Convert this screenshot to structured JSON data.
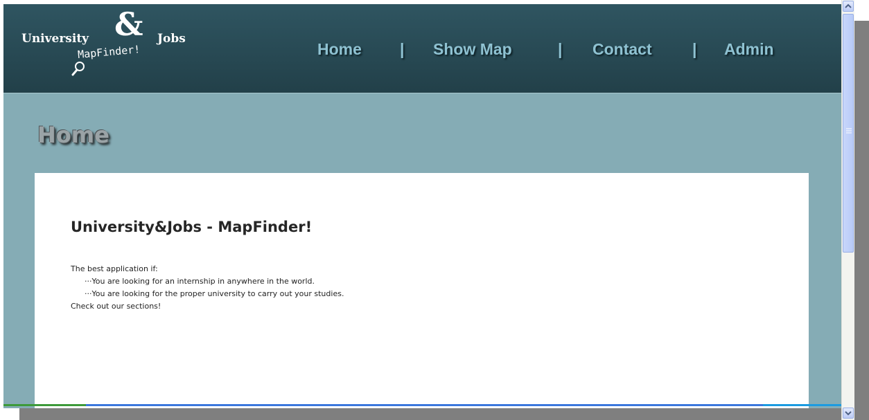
{
  "header": {
    "logo": {
      "word_left": "University",
      "ampersand": "&",
      "word_right": "Jobs",
      "subtitle": "MapFinder!"
    },
    "nav": [
      {
        "label": "Home"
      },
      {
        "label": "Show Map"
      },
      {
        "label": "Contact"
      },
      {
        "label": "Admin"
      }
    ],
    "separator": "|"
  },
  "page": {
    "title": "Home"
  },
  "content": {
    "heading": "University&Jobs - MapFinder!",
    "intro": "The best application if:",
    "points": [
      "···You are looking for an internship in anywhere in the world.",
      "···You are looking for the proper university to carry out your studies."
    ],
    "outro": "Check out our sections!"
  },
  "colors": {
    "header_bg": "#2a4a54",
    "page_bg": "#85acb5",
    "nav_text": "#8fc2d2",
    "panel_bg": "#ffffff"
  }
}
